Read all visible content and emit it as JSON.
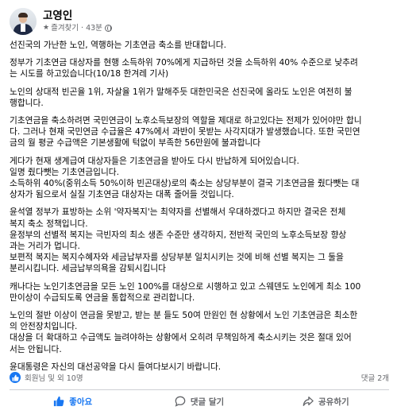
{
  "post": {
    "author": "고영인",
    "favorite_label": "즐겨찾기",
    "time": "43분",
    "paragraphs": [
      [
        "선진국의 가난한 노인, 역행하는 기초연금 축소를 반대합니다."
      ],
      [
        "정부가 기초연금 대상자를 현행 소득하위 70%에게 지급하던 것을 소득하위 40% 수준으로 낮추려",
        "는 시도를 하고있습니다(10/18  한겨레 기사)"
      ],
      [
        "노인의 상대적 빈곤율 1위, 자살율 1위가 말해주듯 대한민국은 선진국에 올라도 노인은 여전히 불",
        "행합니다."
      ],
      [
        "기초연금을 축소하려면 국민연금이 노후소득보장의 역할을 제대로 하고있다는 전제가 있어야만 합니",
        "다. 그러나 현재 국민연금 수급율은 47%에서 과반이 못받는 사각지대가 발생했습니다. 또한 국민연",
        "금의 월 평균 수급액은 기본생활에 턱없이 부족한 56만원에 불과합니다"
      ],
      [
        "게다가 현재 생계급여 대상자들은 기초연금을 받아도 다시 반납하게 되어있습니다.",
        "일명 줬다뺏는 기초연금입니다.",
        "소득하위 40%(중위소득 50%이하 빈곤대상)로의 축소는 상당부분이 결국 기초연금을 줬다뺏는 대",
        "상자가 됨으로서 실질 기초연금 대상자는 대폭 줄어들 것입니다."
      ],
      [
        "윤석열 정부가 표방하는 소위 '약자복지'는 최약자를 선별해서 우대하겠다고 하지만 결국은 전체",
        "복지 축소 정책입니다.",
        "윤정부의 선별적 복지는 극빈자의 최소 생존 수준만 생각하지, 전반적 국민의 노후소득보장 향상",
        "과는 거리가 멉니다.",
        "보편적 복지는 복지수혜자와 세금납부자를 상당부분 일치시키는 것에 비해 선별 복지는 그 둘을",
        "분리시킵니다. 세금납부의욕을 감퇴시킵니다"
      ],
      [
        "캐나다는 노인기초연금을 모든 노인 100%를 대상으로 시행하고 있고 스웨덴도 노인에게 최소 100",
        "만이상이 수급되도록 연금을 통합적으로 관리합니다."
      ],
      [
        "노인의 절반 이상이 연금을 못받고, 받는 분 들도 50여 만원인 현 상황에서 노인 기초연금은 최소한",
        "의 안전장치입니다.",
        "대상을 더 확대하고 수급액도 늘려야하는 상황에서 오히려 무책임하게 축소시키는 것은 절대 있어",
        "서는 안됩니다."
      ],
      [
        "윤대통령은 자신의 대선공약을 다시 들여다보시기 바랍니다."
      ]
    ],
    "reactions_text": "회원님 및 외 10명",
    "comments_text": "댓글 2개",
    "actions": {
      "like": "좋아요",
      "comment": "댓글 달기",
      "share": "공유하기"
    },
    "colors": {
      "accent": "#1877f2",
      "muted": "#65676b",
      "text": "#050505",
      "divider": "#ced0d4"
    }
  }
}
